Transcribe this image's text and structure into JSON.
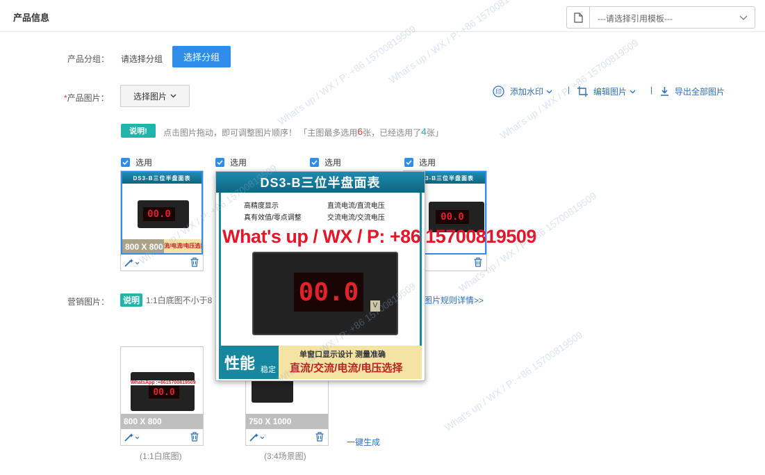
{
  "header": {
    "title": "产品信息",
    "template_select": "---请选择引用模板---"
  },
  "group": {
    "label": "产品分组：",
    "placeholder": "请选择分组",
    "button": "选择分组"
  },
  "product_images": {
    "required_mark": "*",
    "label": "产品图片：",
    "select_button": "选择图片",
    "tools": {
      "watermark": "添加水印",
      "edit": "编辑图片",
      "export": "导出全部图片",
      "separator": "|"
    },
    "hint_badge": "说明!",
    "hint_prefix": "点击图片拖动，即可调整图片顺序！ 「主图最多选用",
    "hint_max": "6",
    "hint_middle": "张，已经选用了",
    "hint_used": "4",
    "hint_suffix": "张」",
    "checkbox_label": "选用",
    "thumb_title": "DS3-B三位半盘面表",
    "thumb_size_tag": "800 X 800",
    "thumb_banner": "流/电流/电压选择"
  },
  "popup": {
    "title": "DS3-B三位半盘面表",
    "features": [
      "高精度显示",
      "直流电流/直流电压",
      "真有效值/零点调整",
      "交流电流/交流电压"
    ],
    "display": "00.0",
    "unit": "V",
    "footer_big": "性能",
    "footer_small": "稳定",
    "footer_line1": "单窗口显示设计  测量准确",
    "footer_line2": "直流/交流/电流/电压选择"
  },
  "watermark_text": "What's up / WX / P: +86 15700819509",
  "marketing": {
    "label": "营销图片：",
    "hint_badge": "说明",
    "hint_text": "1:1白底图不小于8",
    "rule_link": "图片规则详情>>",
    "overlay_text": "WhatsApp :+8615700819509",
    "cards": [
      {
        "size": "800 X 800",
        "caption": "(1:1白底图)"
      },
      {
        "size": "750 X 1000",
        "caption": "(3:4场景图)"
      }
    ],
    "generate_link": "一键生成"
  }
}
